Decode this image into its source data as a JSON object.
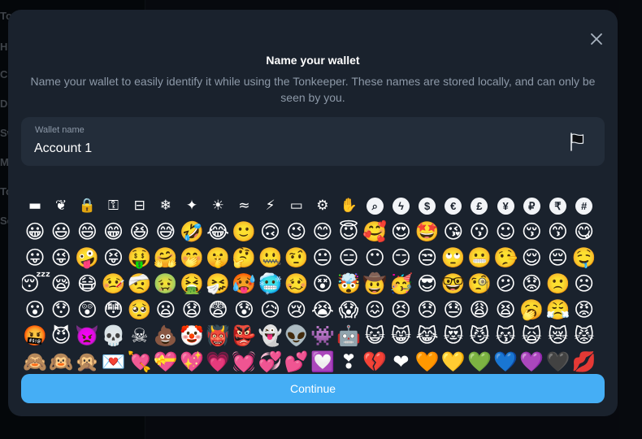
{
  "background": {
    "nav_items": [
      "To",
      "Hi",
      "Co",
      "De",
      "Sw",
      "M",
      "To",
      "Se"
    ]
  },
  "modal": {
    "title": "Name your wallet",
    "description": "Name your wallet to easily identify it while using the Tonkeeper. These names are stored locally, and can only be seen by you.",
    "field_label": "Wallet name",
    "field_value": "Account 1",
    "continue_label": "Continue",
    "accent_color": "#45aef5"
  },
  "icons": [
    {
      "name": "wallet-icon",
      "glyph": "▬"
    },
    {
      "name": "leaf-icon",
      "glyph": "❦"
    },
    {
      "name": "lock-icon",
      "glyph": "🔒"
    },
    {
      "name": "key-icon",
      "glyph": "⚿"
    },
    {
      "name": "inbox-icon",
      "glyph": "⊟"
    },
    {
      "name": "snowflake-icon",
      "glyph": "❄"
    },
    {
      "name": "sparkles-icon",
      "glyph": "✦"
    },
    {
      "name": "sun-icon",
      "glyph": "☀"
    },
    {
      "name": "bird-icon",
      "glyph": "≈"
    },
    {
      "name": "lightning-icon",
      "glyph": "⚡"
    },
    {
      "name": "credit-card-icon",
      "glyph": "▭"
    },
    {
      "name": "gear-icon",
      "glyph": "⚙"
    },
    {
      "name": "hand-icon",
      "glyph": "✋"
    },
    {
      "name": "search-circle-icon",
      "glyph": "⌕",
      "circle": true
    },
    {
      "name": "lightning-circle-icon",
      "glyph": "ϟ",
      "circle": true
    },
    {
      "name": "dollar-circle-icon",
      "glyph": "$",
      "circle": true
    },
    {
      "name": "euro-circle-icon",
      "glyph": "€",
      "circle": true
    },
    {
      "name": "pound-circle-icon",
      "glyph": "£",
      "circle": true
    },
    {
      "name": "yen-circle-icon",
      "glyph": "¥",
      "circle": true
    },
    {
      "name": "ruble-circle-icon",
      "glyph": "₽",
      "circle": true
    },
    {
      "name": "rupee-circle-icon",
      "glyph": "₹",
      "circle": true
    },
    {
      "name": "hash-circle-icon",
      "glyph": "#",
      "circle": true
    }
  ],
  "emojis": [
    "😀",
    "😃",
    "😄",
    "😁",
    "😆",
    "😅",
    "🤣",
    "😂",
    "🙂",
    "🙃",
    "😉",
    "😊",
    "😇",
    "🥰",
    "😍",
    "🤩",
    "😘",
    "😗",
    "☺",
    "😚",
    "😙",
    "😋",
    "😛",
    "😜",
    "🤪",
    "😝",
    "🤑",
    "🤗",
    "🤭",
    "🤫",
    "🤔",
    "🤐",
    "🤨",
    "😐",
    "😑",
    "😶",
    "😏",
    "😒",
    "🙄",
    "😬",
    "🤥",
    "😌",
    "😔",
    "🤤",
    "😴",
    "😪",
    "😷",
    "🤒",
    "🤕",
    "🤢",
    "🤮",
    "🤧",
    "🥵",
    "🥶",
    "🥴",
    "😵",
    "🤯",
    "🤠",
    "🥳",
    "😎",
    "🤓",
    "🧐",
    "😕",
    "😟",
    "🙁",
    "☹",
    "😮",
    "😯",
    "😲",
    "😳",
    "🥺",
    "😦",
    "😧",
    "😨",
    "😰",
    "😥",
    "😢",
    "😭",
    "😱",
    "😖",
    "😣",
    "😞",
    "😓",
    "😩",
    "😫",
    "🥱",
    "😤",
    "😡",
    "🤬",
    "😈",
    "👿",
    "💀",
    "☠",
    "💩",
    "🤡",
    "👹",
    "👺",
    "👻",
    "👽",
    "👾",
    "🤖",
    "😺",
    "😸",
    "😹",
    "😻",
    "😼",
    "😽",
    "🙀",
    "😿",
    "😾",
    "🙈",
    "🙉",
    "🙊",
    "💌",
    "💘",
    "💝",
    "💖",
    "💗",
    "💓",
    "💞",
    "💕",
    "💟",
    "❣",
    "💔",
    "❤",
    "🧡",
    "💛",
    "💚",
    "💙",
    "💜",
    "🖤",
    "💋"
  ]
}
